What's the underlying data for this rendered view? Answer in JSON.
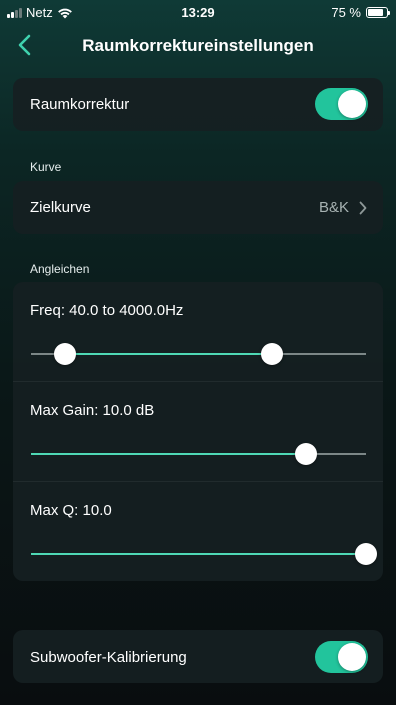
{
  "status_bar": {
    "carrier": "Netz",
    "time": "13:29",
    "battery": "75 %",
    "battery_level": 0.75
  },
  "nav": {
    "title": "Raumkorrektureinstellungen",
    "back_icon": "chevron-left-icon"
  },
  "room_correction": {
    "label": "Raumkorrektur",
    "enabled": true
  },
  "curve_section": {
    "header": "Kurve",
    "target_curve": {
      "label": "Zielkurve",
      "value": "B&K"
    }
  },
  "equalize_section": {
    "header": "Angleichen",
    "freq": {
      "label": "Freq: 40.0 to 4000.0Hz",
      "low_fraction": 0.1,
      "high_fraction": 0.72
    },
    "max_gain": {
      "label": "Max Gain: 10.0 dB",
      "fraction": 0.82
    },
    "max_q": {
      "label": "Max Q: 10.0",
      "fraction": 1.0
    }
  },
  "subwoofer": {
    "label": "Subwoofer-Kalibrierung",
    "enabled": true
  },
  "colors": {
    "accent": "#22c49c",
    "slider_active": "#4fd9b5"
  }
}
